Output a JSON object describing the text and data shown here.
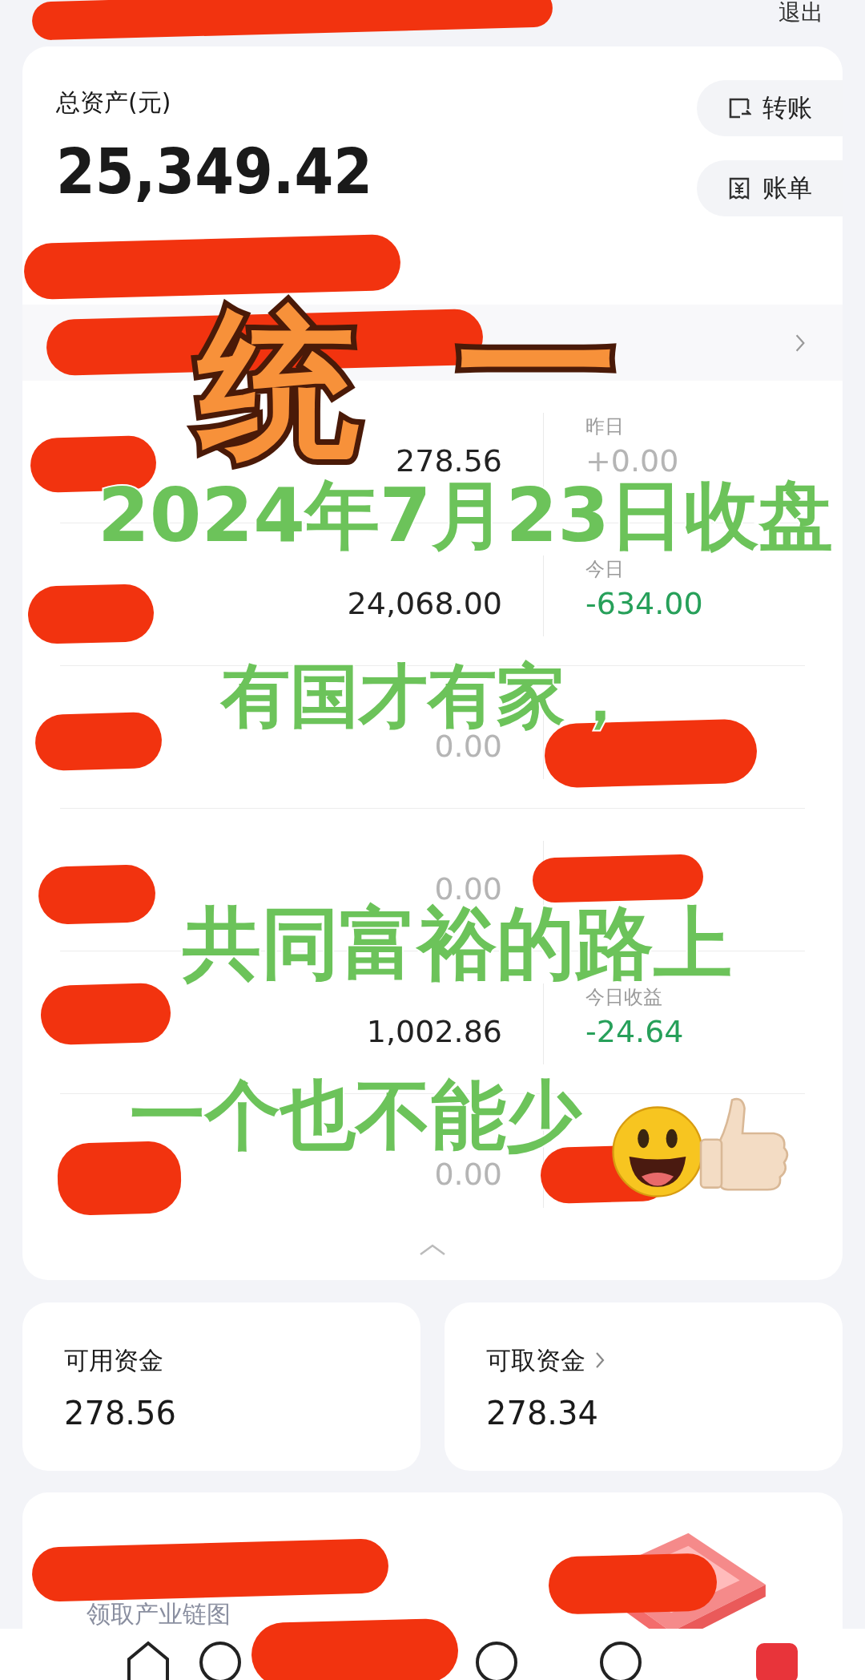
{
  "header": {
    "logout": "退出"
  },
  "assets": {
    "label": "总资产(元)",
    "total": "25,349.42",
    "actions": [
      {
        "label": "转账",
        "kind": "transfer"
      },
      {
        "label": "账单",
        "kind": "bill"
      }
    ]
  },
  "holdings": [
    {
      "value": "278.56",
      "muted": false,
      "change_label": "昨日",
      "change": "+0.00",
      "color": "#b5b5b5"
    },
    {
      "value": "24,068.00",
      "muted": false,
      "change_label": "今日",
      "change": "-634.00",
      "color": "#27a05a"
    },
    {
      "value": "0.00",
      "muted": true
    },
    {
      "value": "0.00",
      "muted": true
    },
    {
      "value": "1,002.86",
      "muted": false,
      "change_label": "今日收益",
      "change": "-24.64",
      "color": "#27a05a"
    },
    {
      "value": "0.00",
      "muted": true
    }
  ],
  "funds": [
    {
      "label": "可用资金",
      "value": "278.56",
      "link": false
    },
    {
      "label": "可取资金",
      "value": "278.34",
      "link": true
    }
  ],
  "promo": {
    "text": "领取产业链图"
  },
  "overlay": [
    {
      "text": "统",
      "kind": "headline"
    },
    {
      "text": "一",
      "kind": "headline"
    },
    {
      "text": "2024年7月23日收盘",
      "kind": "caption"
    },
    {
      "text": "有国才有家，",
      "kind": "caption"
    },
    {
      "text": "共同富裕的路上",
      "kind": "caption"
    },
    {
      "text": "一个也不能少",
      "kind": "caption"
    }
  ]
}
